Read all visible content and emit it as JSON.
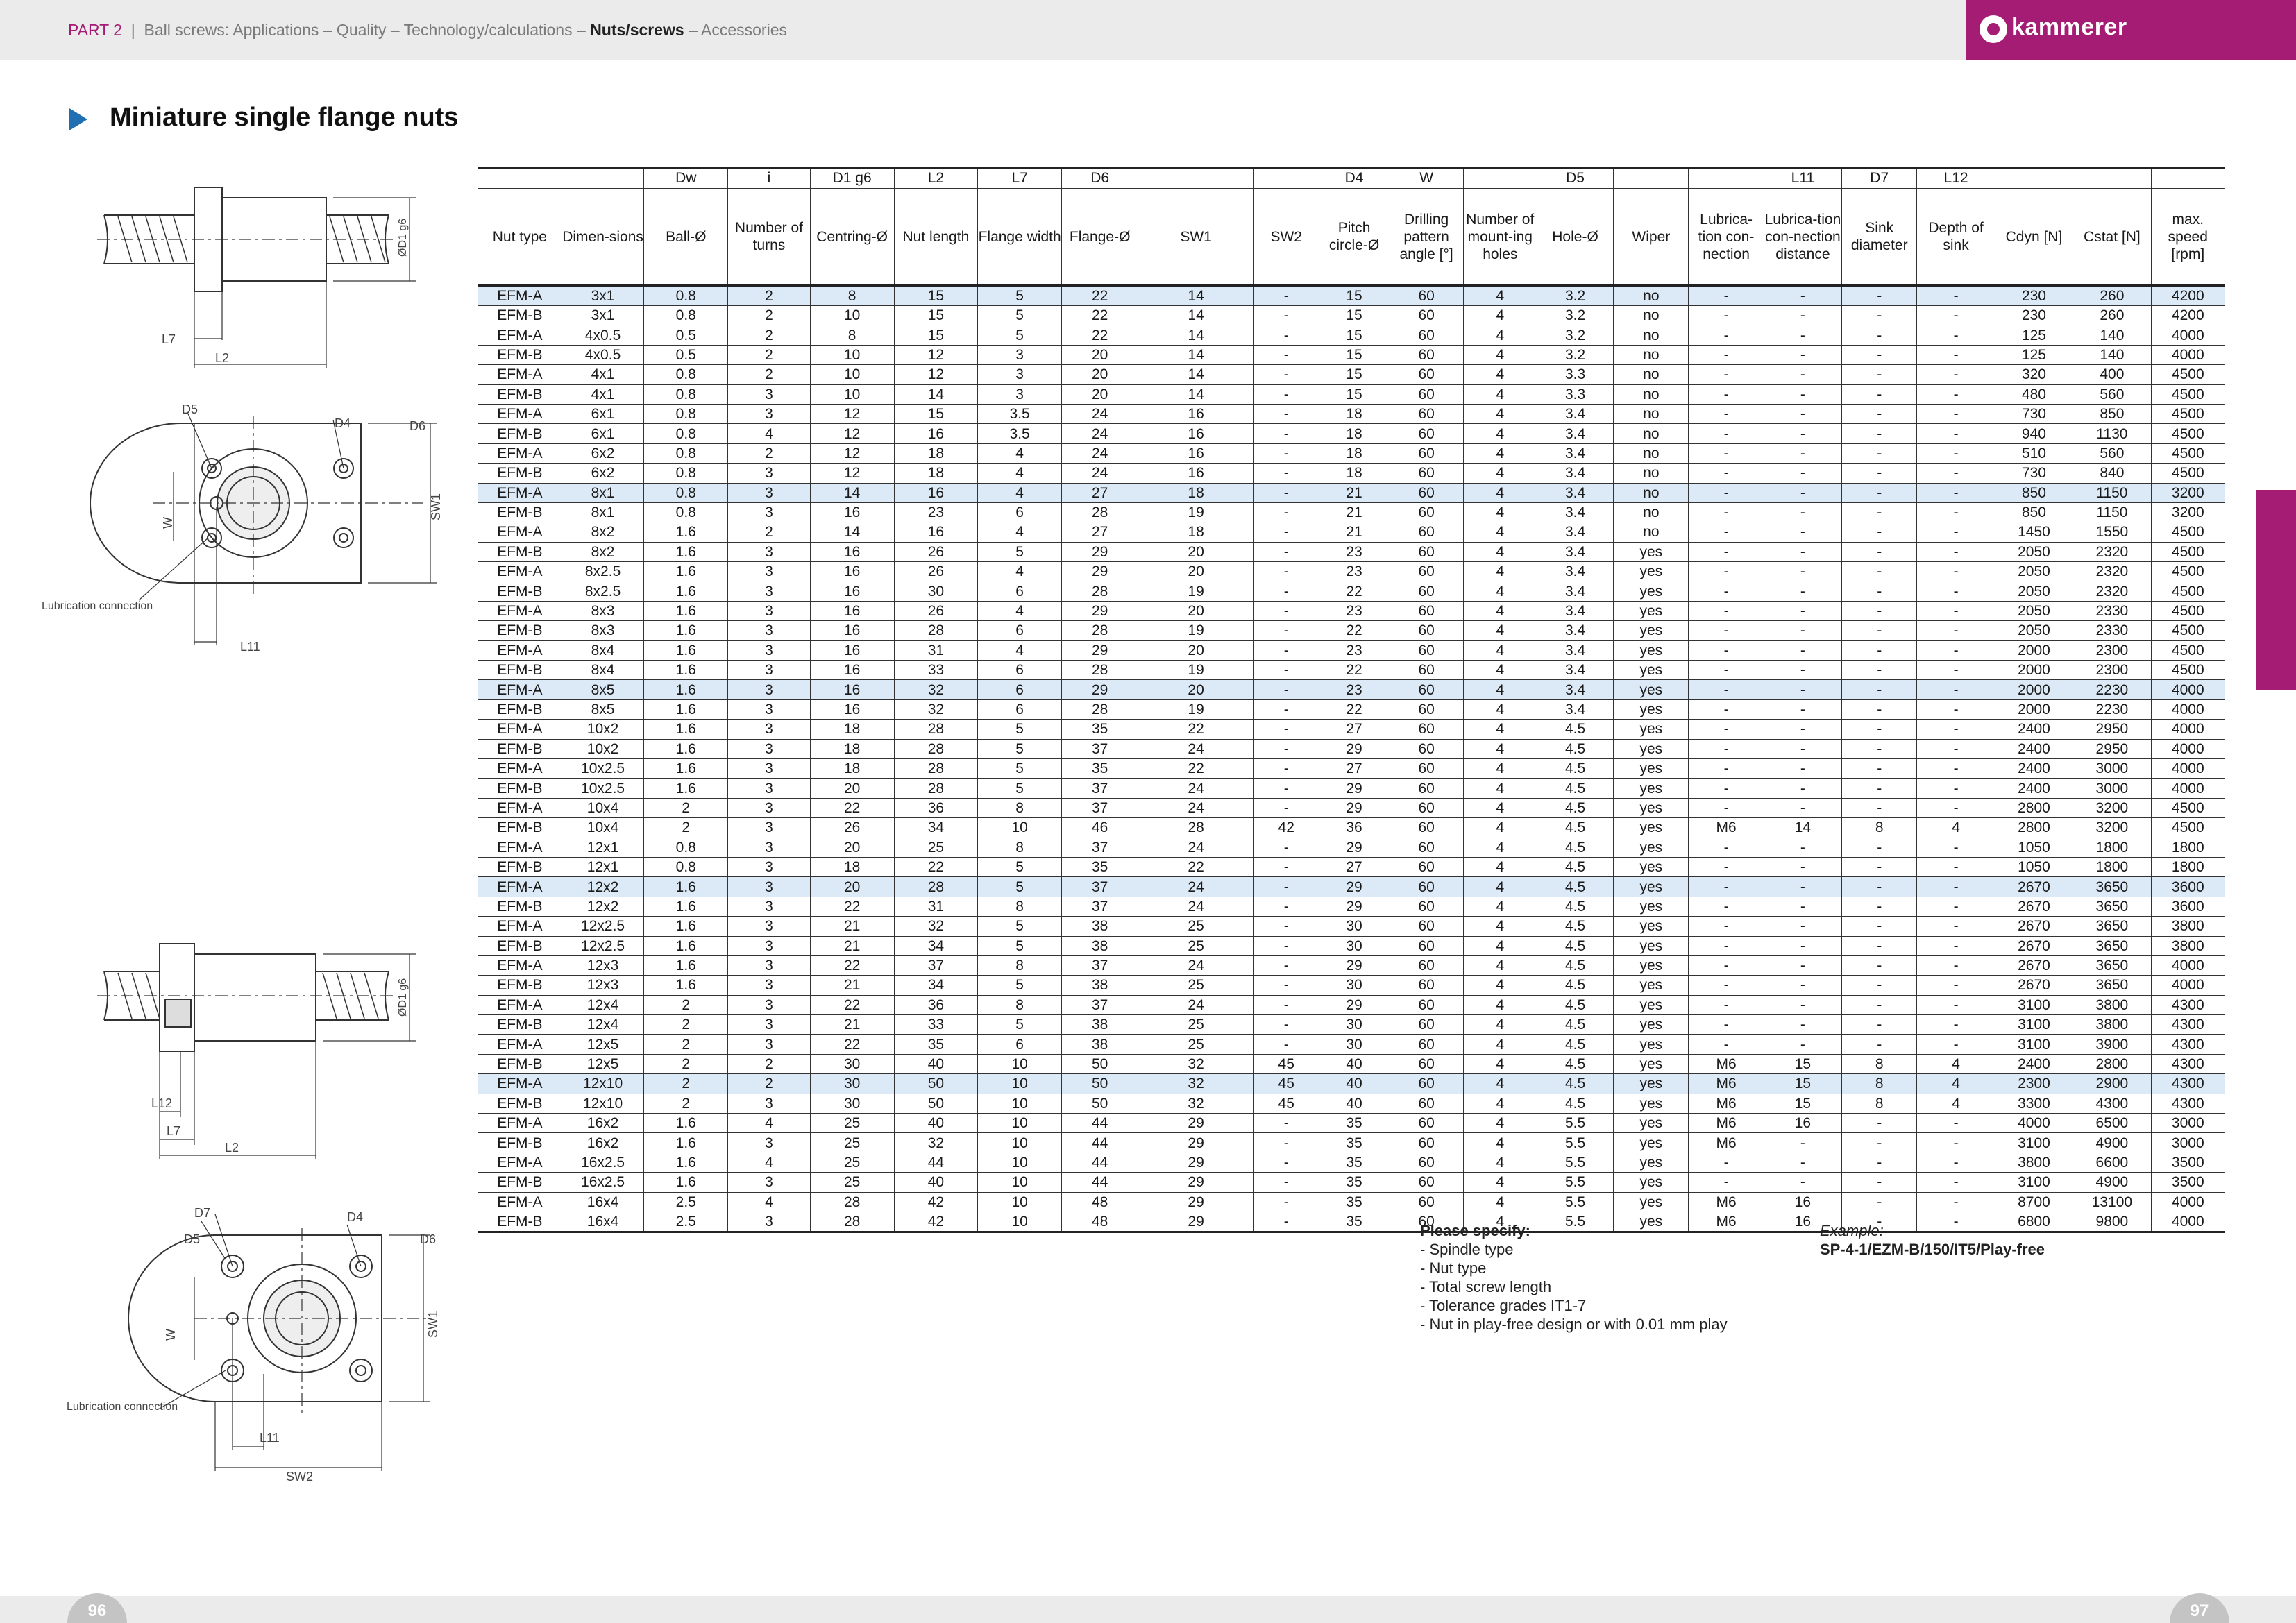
{
  "header": {
    "part": "PART 2",
    "sep": "|",
    "crumbs_before": "Ball screws: Applications – Quality – Technology/calculations –",
    "current": "Nuts/screws",
    "crumbs_after": "– Accessories",
    "brand": "kammerer"
  },
  "page_title": "Miniature single flange nuts",
  "drawings": {
    "labels": {
      "d1g6": "ØD1 g6",
      "l7": "L7",
      "l2": "L2",
      "l11": "L11",
      "l12": "L12",
      "d4": "D4",
      "d5": "D5",
      "d6": "D6",
      "d7": "D7",
      "w": "W",
      "sw1": "SW1",
      "sw2": "SW2",
      "lube": "Lubrication connection"
    }
  },
  "table": {
    "symbols": [
      "",
      "",
      "Dw",
      "i",
      "D1 g6",
      "L2",
      "L7",
      "D6",
      "",
      "",
      "D4",
      "W",
      "",
      "D5",
      "",
      "",
      "L11",
      "D7",
      "L12",
      "",
      "",
      ""
    ],
    "labels": [
      "Nut type",
      "Dimen-sions",
      "Ball-Ø",
      "Number of turns",
      "Centring-Ø",
      "Nut length",
      "Flange width",
      "Flange-Ø",
      "SW1",
      "SW2",
      "Pitch circle-Ø",
      "Drilling pattern angle [°]",
      "Number of mount-ing holes",
      "Hole-Ø",
      "Wiper",
      "Lubrica-tion con-nection",
      "Lubrica-tion con-nection distance",
      "Sink diameter",
      "Depth of sink",
      "Cdyn [N]",
      "Cstat [N]",
      "max. speed [rpm]"
    ],
    "rows": [
      [
        "EFM-A",
        "3x1",
        "0.8",
        "2",
        "8",
        "15",
        "5",
        "22",
        "14",
        "-",
        "15",
        "60",
        "4",
        "3.2",
        "no",
        "-",
        "-",
        "-",
        "-",
        "230",
        "260",
        "4200"
      ],
      [
        "EFM-B",
        "3x1",
        "0.8",
        "2",
        "10",
        "15",
        "5",
        "22",
        "14",
        "-",
        "15",
        "60",
        "4",
        "3.2",
        "no",
        "-",
        "-",
        "-",
        "-",
        "230",
        "260",
        "4200"
      ],
      [
        "EFM-A",
        "4x0.5",
        "0.5",
        "2",
        "8",
        "15",
        "5",
        "22",
        "14",
        "-",
        "15",
        "60",
        "4",
        "3.2",
        "no",
        "-",
        "-",
        "-",
        "-",
        "125",
        "140",
        "4000"
      ],
      [
        "EFM-B",
        "4x0.5",
        "0.5",
        "2",
        "10",
        "12",
        "3",
        "20",
        "14",
        "-",
        "15",
        "60",
        "4",
        "3.2",
        "no",
        "-",
        "-",
        "-",
        "-",
        "125",
        "140",
        "4000"
      ],
      [
        "EFM-A",
        "4x1",
        "0.8",
        "2",
        "10",
        "12",
        "3",
        "20",
        "14",
        "-",
        "15",
        "60",
        "4",
        "3.3",
        "no",
        "-",
        "-",
        "-",
        "-",
        "320",
        "400",
        "4500"
      ],
      [
        "EFM-B",
        "4x1",
        "0.8",
        "3",
        "10",
        "14",
        "3",
        "20",
        "14",
        "-",
        "15",
        "60",
        "4",
        "3.3",
        "no",
        "-",
        "-",
        "-",
        "-",
        "480",
        "560",
        "4500"
      ],
      [
        "EFM-A",
        "6x1",
        "0.8",
        "3",
        "12",
        "15",
        "3.5",
        "24",
        "16",
        "-",
        "18",
        "60",
        "4",
        "3.4",
        "no",
        "-",
        "-",
        "-",
        "-",
        "730",
        "850",
        "4500"
      ],
      [
        "EFM-B",
        "6x1",
        "0.8",
        "4",
        "12",
        "16",
        "3.5",
        "24",
        "16",
        "-",
        "18",
        "60",
        "4",
        "3.4",
        "no",
        "-",
        "-",
        "-",
        "-",
        "940",
        "1130",
        "4500"
      ],
      [
        "EFM-A",
        "6x2",
        "0.8",
        "2",
        "12",
        "18",
        "4",
        "24",
        "16",
        "-",
        "18",
        "60",
        "4",
        "3.4",
        "no",
        "-",
        "-",
        "-",
        "-",
        "510",
        "560",
        "4500"
      ],
      [
        "EFM-B",
        "6x2",
        "0.8",
        "3",
        "12",
        "18",
        "4",
        "24",
        "16",
        "-",
        "18",
        "60",
        "4",
        "3.4",
        "no",
        "-",
        "-",
        "-",
        "-",
        "730",
        "840",
        "4500"
      ],
      [
        "EFM-A",
        "8x1",
        "0.8",
        "3",
        "14",
        "16",
        "4",
        "27",
        "18",
        "-",
        "21",
        "60",
        "4",
        "3.4",
        "no",
        "-",
        "-",
        "-",
        "-",
        "850",
        "1150",
        "3200"
      ],
      [
        "EFM-B",
        "8x1",
        "0.8",
        "3",
        "16",
        "23",
        "6",
        "28",
        "19",
        "-",
        "21",
        "60",
        "4",
        "3.4",
        "no",
        "-",
        "-",
        "-",
        "-",
        "850",
        "1150",
        "3200"
      ],
      [
        "EFM-A",
        "8x2",
        "1.6",
        "2",
        "14",
        "16",
        "4",
        "27",
        "18",
        "-",
        "21",
        "60",
        "4",
        "3.4",
        "no",
        "-",
        "-",
        "-",
        "-",
        "1450",
        "1550",
        "4500"
      ],
      [
        "EFM-B",
        "8x2",
        "1.6",
        "3",
        "16",
        "26",
        "5",
        "29",
        "20",
        "-",
        "23",
        "60",
        "4",
        "3.4",
        "yes",
        "-",
        "-",
        "-",
        "-",
        "2050",
        "2320",
        "4500"
      ],
      [
        "EFM-A",
        "8x2.5",
        "1.6",
        "3",
        "16",
        "26",
        "4",
        "29",
        "20",
        "-",
        "23",
        "60",
        "4",
        "3.4",
        "yes",
        "-",
        "-",
        "-",
        "-",
        "2050",
        "2320",
        "4500"
      ],
      [
        "EFM-B",
        "8x2.5",
        "1.6",
        "3",
        "16",
        "30",
        "6",
        "28",
        "19",
        "-",
        "22",
        "60",
        "4",
        "3.4",
        "yes",
        "-",
        "-",
        "-",
        "-",
        "2050",
        "2320",
        "4500"
      ],
      [
        "EFM-A",
        "8x3",
        "1.6",
        "3",
        "16",
        "26",
        "4",
        "29",
        "20",
        "-",
        "23",
        "60",
        "4",
        "3.4",
        "yes",
        "-",
        "-",
        "-",
        "-",
        "2050",
        "2330",
        "4500"
      ],
      [
        "EFM-B",
        "8x3",
        "1.6",
        "3",
        "16",
        "28",
        "6",
        "28",
        "19",
        "-",
        "22",
        "60",
        "4",
        "3.4",
        "yes",
        "-",
        "-",
        "-",
        "-",
        "2050",
        "2330",
        "4500"
      ],
      [
        "EFM-A",
        "8x4",
        "1.6",
        "3",
        "16",
        "31",
        "4",
        "29",
        "20",
        "-",
        "23",
        "60",
        "4",
        "3.4",
        "yes",
        "-",
        "-",
        "-",
        "-",
        "2000",
        "2300",
        "4500"
      ],
      [
        "EFM-B",
        "8x4",
        "1.6",
        "3",
        "16",
        "33",
        "6",
        "28",
        "19",
        "-",
        "22",
        "60",
        "4",
        "3.4",
        "yes",
        "-",
        "-",
        "-",
        "-",
        "2000",
        "2300",
        "4500"
      ],
      [
        "EFM-A",
        "8x5",
        "1.6",
        "3",
        "16",
        "32",
        "6",
        "29",
        "20",
        "-",
        "23",
        "60",
        "4",
        "3.4",
        "yes",
        "-",
        "-",
        "-",
        "-",
        "2000",
        "2230",
        "4000"
      ],
      [
        "EFM-B",
        "8x5",
        "1.6",
        "3",
        "16",
        "32",
        "6",
        "28",
        "19",
        "-",
        "22",
        "60",
        "4",
        "3.4",
        "yes",
        "-",
        "-",
        "-",
        "-",
        "2000",
        "2230",
        "4000"
      ],
      [
        "EFM-A",
        "10x2",
        "1.6",
        "3",
        "18",
        "28",
        "5",
        "35",
        "22",
        "-",
        "27",
        "60",
        "4",
        "4.5",
        "yes",
        "-",
        "-",
        "-",
        "-",
        "2400",
        "2950",
        "4000"
      ],
      [
        "EFM-B",
        "10x2",
        "1.6",
        "3",
        "18",
        "28",
        "5",
        "37",
        "24",
        "-",
        "29",
        "60",
        "4",
        "4.5",
        "yes",
        "-",
        "-",
        "-",
        "-",
        "2400",
        "2950",
        "4000"
      ],
      [
        "EFM-A",
        "10x2.5",
        "1.6",
        "3",
        "18",
        "28",
        "5",
        "35",
        "22",
        "-",
        "27",
        "60",
        "4",
        "4.5",
        "yes",
        "-",
        "-",
        "-",
        "-",
        "2400",
        "3000",
        "4000"
      ],
      [
        "EFM-B",
        "10x2.5",
        "1.6",
        "3",
        "20",
        "28",
        "5",
        "37",
        "24",
        "-",
        "29",
        "60",
        "4",
        "4.5",
        "yes",
        "-",
        "-",
        "-",
        "-",
        "2400",
        "3000",
        "4000"
      ],
      [
        "EFM-A",
        "10x4",
        "2",
        "3",
        "22",
        "36",
        "8",
        "37",
        "24",
        "-",
        "29",
        "60",
        "4",
        "4.5",
        "yes",
        "-",
        "-",
        "-",
        "-",
        "2800",
        "3200",
        "4500"
      ],
      [
        "EFM-B",
        "10x4",
        "2",
        "3",
        "26",
        "34",
        "10",
        "46",
        "28",
        "42",
        "36",
        "60",
        "4",
        "4.5",
        "yes",
        "M6",
        "14",
        "8",
        "4",
        "2800",
        "3200",
        "4500"
      ],
      [
        "EFM-A",
        "12x1",
        "0.8",
        "3",
        "20",
        "25",
        "8",
        "37",
        "24",
        "-",
        "29",
        "60",
        "4",
        "4.5",
        "yes",
        "-",
        "-",
        "-",
        "-",
        "1050",
        "1800",
        "1800"
      ],
      [
        "EFM-B",
        "12x1",
        "0.8",
        "3",
        "18",
        "22",
        "5",
        "35",
        "22",
        "-",
        "27",
        "60",
        "4",
        "4.5",
        "yes",
        "-",
        "-",
        "-",
        "-",
        "1050",
        "1800",
        "1800"
      ],
      [
        "EFM-A",
        "12x2",
        "1.6",
        "3",
        "20",
        "28",
        "5",
        "37",
        "24",
        "-",
        "29",
        "60",
        "4",
        "4.5",
        "yes",
        "-",
        "-",
        "-",
        "-",
        "2670",
        "3650",
        "3600"
      ],
      [
        "EFM-B",
        "12x2",
        "1.6",
        "3",
        "22",
        "31",
        "8",
        "37",
        "24",
        "-",
        "29",
        "60",
        "4",
        "4.5",
        "yes",
        "-",
        "-",
        "-",
        "-",
        "2670",
        "3650",
        "3600"
      ],
      [
        "EFM-A",
        "12x2.5",
        "1.6",
        "3",
        "21",
        "32",
        "5",
        "38",
        "25",
        "-",
        "30",
        "60",
        "4",
        "4.5",
        "yes",
        "-",
        "-",
        "-",
        "-",
        "2670",
        "3650",
        "3800"
      ],
      [
        "EFM-B",
        "12x2.5",
        "1.6",
        "3",
        "21",
        "34",
        "5",
        "38",
        "25",
        "-",
        "30",
        "60",
        "4",
        "4.5",
        "yes",
        "-",
        "-",
        "-",
        "-",
        "2670",
        "3650",
        "3800"
      ],
      [
        "EFM-A",
        "12x3",
        "1.6",
        "3",
        "22",
        "37",
        "8",
        "37",
        "24",
        "-",
        "29",
        "60",
        "4",
        "4.5",
        "yes",
        "-",
        "-",
        "-",
        "-",
        "2670",
        "3650",
        "4000"
      ],
      [
        "EFM-B",
        "12x3",
        "1.6",
        "3",
        "21",
        "34",
        "5",
        "38",
        "25",
        "-",
        "30",
        "60",
        "4",
        "4.5",
        "yes",
        "-",
        "-",
        "-",
        "-",
        "2670",
        "3650",
        "4000"
      ],
      [
        "EFM-A",
        "12x4",
        "2",
        "3",
        "22",
        "36",
        "8",
        "37",
        "24",
        "-",
        "29",
        "60",
        "4",
        "4.5",
        "yes",
        "-",
        "-",
        "-",
        "-",
        "3100",
        "3800",
        "4300"
      ],
      [
        "EFM-B",
        "12x4",
        "2",
        "3",
        "21",
        "33",
        "5",
        "38",
        "25",
        "-",
        "30",
        "60",
        "4",
        "4.5",
        "yes",
        "-",
        "-",
        "-",
        "-",
        "3100",
        "3800",
        "4300"
      ],
      [
        "EFM-A",
        "12x5",
        "2",
        "3",
        "22",
        "35",
        "6",
        "38",
        "25",
        "-",
        "30",
        "60",
        "4",
        "4.5",
        "yes",
        "-",
        "-",
        "-",
        "-",
        "3100",
        "3900",
        "4300"
      ],
      [
        "EFM-B",
        "12x5",
        "2",
        "2",
        "30",
        "40",
        "10",
        "50",
        "32",
        "45",
        "40",
        "60",
        "4",
        "4.5",
        "yes",
        "M6",
        "15",
        "8",
        "4",
        "2400",
        "2800",
        "4300"
      ],
      [
        "EFM-A",
        "12x10",
        "2",
        "2",
        "30",
        "50",
        "10",
        "50",
        "32",
        "45",
        "40",
        "60",
        "4",
        "4.5",
        "yes",
        "M6",
        "15",
        "8",
        "4",
        "2300",
        "2900",
        "4300"
      ],
      [
        "EFM-B",
        "12x10",
        "2",
        "3",
        "30",
        "50",
        "10",
        "50",
        "32",
        "45",
        "40",
        "60",
        "4",
        "4.5",
        "yes",
        "M6",
        "15",
        "8",
        "4",
        "3300",
        "4300",
        "4300"
      ],
      [
        "EFM-A",
        "16x2",
        "1.6",
        "4",
        "25",
        "40",
        "10",
        "44",
        "29",
        "-",
        "35",
        "60",
        "4",
        "5.5",
        "yes",
        "M6",
        "16",
        "-",
        "-",
        "4000",
        "6500",
        "3000"
      ],
      [
        "EFM-B",
        "16x2",
        "1.6",
        "3",
        "25",
        "32",
        "10",
        "44",
        "29",
        "-",
        "35",
        "60",
        "4",
        "5.5",
        "yes",
        "M6",
        "-",
        "-",
        "-",
        "3100",
        "4900",
        "3000"
      ],
      [
        "EFM-A",
        "16x2.5",
        "1.6",
        "4",
        "25",
        "44",
        "10",
        "44",
        "29",
        "-",
        "35",
        "60",
        "4",
        "5.5",
        "yes",
        "-",
        "-",
        "-",
        "-",
        "3800",
        "6600",
        "3500"
      ],
      [
        "EFM-B",
        "16x2.5",
        "1.6",
        "3",
        "25",
        "40",
        "10",
        "44",
        "29",
        "-",
        "35",
        "60",
        "4",
        "5.5",
        "yes",
        "-",
        "-",
        "-",
        "-",
        "3100",
        "4900",
        "3500"
      ],
      [
        "EFM-A",
        "16x4",
        "2.5",
        "4",
        "28",
        "42",
        "10",
        "48",
        "29",
        "-",
        "35",
        "60",
        "4",
        "5.5",
        "yes",
        "M6",
        "16",
        "-",
        "-",
        "8700",
        "13100",
        "4000"
      ],
      [
        "EFM-B",
        "16x4",
        "2.5",
        "3",
        "28",
        "42",
        "10",
        "48",
        "29",
        "-",
        "35",
        "60",
        "4",
        "5.5",
        "yes",
        "M6",
        "16",
        "-",
        "-",
        "6800",
        "9800",
        "4000"
      ]
    ],
    "highlight_rows": [
      0,
      10,
      20,
      30,
      40
    ]
  },
  "specify": {
    "heading": "Please specify:",
    "items": [
      "- Spindle type",
      "- Nut type",
      "- Total screw length",
      "- Tolerance grades IT1-7",
      "- Nut in play-free design or with 0.01 mm play"
    ]
  },
  "example": {
    "heading": "Example:",
    "code": "SP-4-1/EZM-B/150/IT5/Play-free"
  },
  "footer": {
    "page_left": "96",
    "page_right": "97"
  },
  "colors": {
    "brand": "#a51c75",
    "accent": "#1f6fb2",
    "row_highlight": "#dce9f6",
    "band": "#ebebeb"
  }
}
